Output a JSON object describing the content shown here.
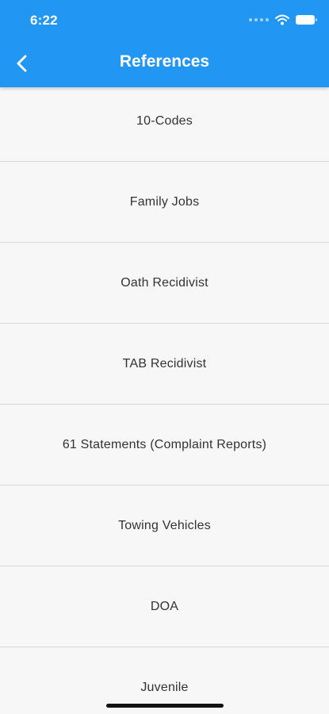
{
  "status_bar": {
    "time": "6:22",
    "icons": [
      "signal-dots-icon",
      "wifi-icon",
      "battery-icon"
    ]
  },
  "header": {
    "title": "References",
    "back_icon": "chevron-left-icon",
    "background": "#2196f3",
    "text_color": "#ffffff"
  },
  "references": [
    {
      "label": "10-Codes"
    },
    {
      "label": "Family Jobs"
    },
    {
      "label": "Oath Recidivist"
    },
    {
      "label": "TAB Recidivist"
    },
    {
      "label": "61 Statements (Complaint Reports)"
    },
    {
      "label": "Towing Vehicles"
    },
    {
      "label": "DOA"
    },
    {
      "label": "Juvenile"
    }
  ]
}
